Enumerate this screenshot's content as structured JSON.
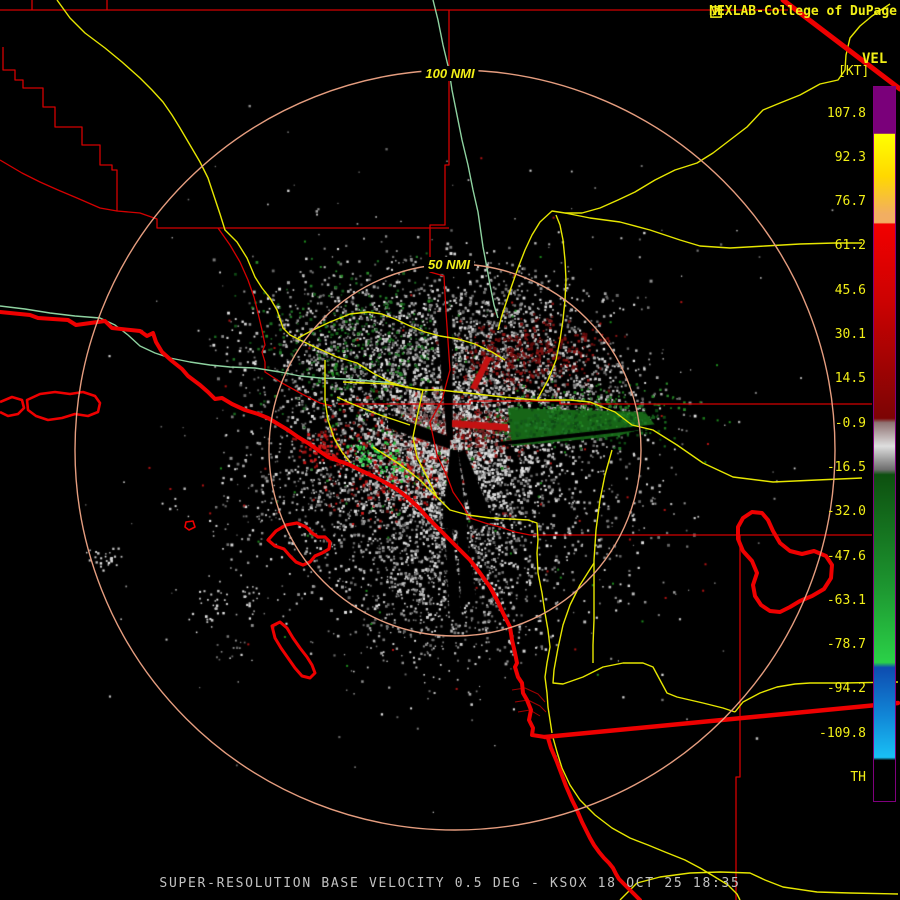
{
  "header": {
    "brand": "NEXLAB-College of DuPage",
    "brand_color": "#f2ef17",
    "logo_icon": "cod-logo-icon"
  },
  "colorbar": {
    "title": "VEL",
    "units": "[KT]",
    "tick_labels": [
      "107.8",
      "92.3",
      "76.7",
      "61.2",
      "45.6",
      "30.1",
      "14.5",
      "-0.9",
      "-16.5",
      "-32.0",
      "-47.6",
      "-63.1",
      "-78.7",
      "-94.2",
      "-109.8",
      "TH"
    ],
    "value_max": 107.8,
    "value_min": -109.8,
    "border_color": "#80007e",
    "gradient_stops": [
      [
        0.0,
        "#7a007a"
      ],
      [
        0.065,
        "#7a007a"
      ],
      [
        0.066,
        "#ffff00"
      ],
      [
        0.125,
        "#ffd800"
      ],
      [
        0.178,
        "#f2ae62"
      ],
      [
        0.19,
        "#f2ae62"
      ],
      [
        0.192,
        "#f20000"
      ],
      [
        0.3,
        "#cc0202"
      ],
      [
        0.464,
        "#7c0404"
      ],
      [
        0.47,
        "#8f7272"
      ],
      [
        0.503,
        "#dedede"
      ],
      [
        0.536,
        "#6e6e6e"
      ],
      [
        0.543,
        "#0d500f"
      ],
      [
        0.7,
        "#1d9630"
      ],
      [
        0.806,
        "#2bd148"
      ],
      [
        0.813,
        "#0e4cb0"
      ],
      [
        0.88,
        "#1186d6"
      ],
      [
        0.939,
        "#19c0f5"
      ],
      [
        0.943,
        "#000000"
      ],
      [
        1.0,
        "#000000"
      ]
    ]
  },
  "rings": {
    "outer_label": "100 NMI",
    "inner_label": "50 NMI",
    "ring_color": "#e59d7f"
  },
  "footer": {
    "caption": "SUPER-RESOLUTION BASE VELOCITY 0.5 DEG - KSOX 18 OCT 25 18:35"
  },
  "map_palette": {
    "county_line": "#d40000",
    "coast_border": "#ee0000",
    "highway": "#e6e600",
    "river": "#8ed2a0",
    "gray_echo": [
      "#bdbdbd",
      "#a8a8a8",
      "#8f8f8f",
      "#d6d6d6",
      "#787878",
      "#e3e3e3",
      "#676767"
    ],
    "light_echo": [
      "#e8e8e8",
      "#dcdcdc",
      "#cfcfcf",
      "#c0c0c0"
    ],
    "dark_red_echo": [
      "#6b0d0d",
      "#7e1111",
      "#8f1616",
      "#5a0a0a"
    ],
    "red_echo": [
      "#c21717",
      "#d41b1b",
      "#a31212"
    ],
    "dark_green_echo": [
      "#14591a",
      "#1a6b20",
      "#0f4a14",
      "#217a28"
    ],
    "bright_green_echo": [
      "#2fd14a",
      "#25c03e",
      "#3ae055"
    ],
    "murk_echo": [
      "#8a7070",
      "#795f5f",
      "#6b5050"
    ]
  }
}
